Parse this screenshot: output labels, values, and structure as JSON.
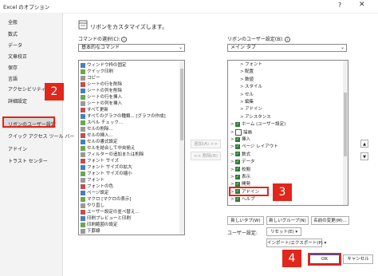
{
  "window": {
    "title": "Excel のオプション",
    "help": "?",
    "close": "✕"
  },
  "sidebar": {
    "items": [
      {
        "label": "全般"
      },
      {
        "label": "数式"
      },
      {
        "label": "データ"
      },
      {
        "label": "文章校正"
      },
      {
        "label": "保存"
      },
      {
        "label": "言語"
      },
      {
        "label": "アクセシビリティ"
      },
      {
        "label": "詳細設定"
      },
      {
        "label": "リボンのユーザー設定"
      },
      {
        "label": "クイック アクセス ツール バー"
      },
      {
        "label": "アドイン"
      },
      {
        "label": "トラスト センター"
      }
    ],
    "active_index": 8
  },
  "annotations": {
    "step2": "2",
    "step3": "3",
    "step4": "4"
  },
  "main": {
    "title": "リボンをカスタマイズします。",
    "commands_label": "コマンドの選択(C):",
    "commands_select": "基本的なコマンド",
    "ribbon_label": "リボンのユーザー設定(B):",
    "ribbon_select": "メイン タブ",
    "command_list": [
      "ウィンドウ枠の固定",
      "クイック印刷",
      "コピー",
      "シートの行を削除",
      "シートの列を削除",
      "シートの行を挿入",
      "シートの列を挿入",
      "すべて更新",
      "すべてのグラフの種類... [グラフの作成]",
      "スペル チェック...",
      "セルの削除...",
      "セルの挿入...",
      "セルの書式設定",
      "セルを結合して中央揃え",
      "フィルターの追加または削除",
      "フォント サイズ",
      "フォント サイズの拡大",
      "フォント サイズの縮小",
      "フォント",
      "フォントの色",
      "ページ設定",
      "マクロ [マクロの表示]",
      "やり直し",
      "ユーザー設定の並べ替え...",
      "印刷プレビューと印刷",
      "印刷範囲の設定",
      "下罫線"
    ],
    "add_button": "追加(A) >>",
    "remove_button": "<< 削除(R)",
    "tree": [
      {
        "label": "フォント",
        "indent": 2,
        "chev": ">",
        "checked": false
      },
      {
        "label": "配置",
        "indent": 2,
        "chev": ">",
        "checked": false
      },
      {
        "label": "数値",
        "indent": 2,
        "chev": ">",
        "checked": false
      },
      {
        "label": "スタイル",
        "indent": 2,
        "chev": ">",
        "checked": false
      },
      {
        "label": "セル",
        "indent": 2,
        "chev": ">",
        "checked": false
      },
      {
        "label": "編集",
        "indent": 2,
        "chev": ">",
        "checked": false
      },
      {
        "label": "アドイン",
        "indent": 2,
        "chev": ">",
        "checked": false
      },
      {
        "label": "アシスタンス",
        "indent": 2,
        "chev": ">",
        "checked": false
      },
      {
        "label": "ホーム (ユーザー設定)",
        "indent": 0,
        "chev": ">",
        "checked": true
      },
      {
        "label": "描画",
        "indent": 0,
        "chev": ">",
        "checked": false
      },
      {
        "label": "挿入",
        "indent": 0,
        "chev": ">",
        "checked": true
      },
      {
        "label": "ページ レイアウト",
        "indent": 0,
        "chev": ">",
        "checked": true
      },
      {
        "label": "数式",
        "indent": 0,
        "chev": ">",
        "checked": true
      },
      {
        "label": "データ",
        "indent": 0,
        "chev": ">",
        "checked": true
      },
      {
        "label": "校閲",
        "indent": 0,
        "chev": ">",
        "checked": true
      },
      {
        "label": "表示",
        "indent": 0,
        "chev": ">",
        "checked": true
      },
      {
        "label": "開発",
        "indent": 0,
        "chev": ">",
        "checked": true
      },
      {
        "label": "アドイン",
        "indent": 0,
        "chev": ">",
        "checked": true
      },
      {
        "label": "ヘルプ",
        "indent": 0,
        "chev": ">",
        "checked": true
      }
    ],
    "new_tab": "新しいタブ(W)",
    "new_group": "新しいグループ(N)",
    "rename": "名前の変更(M)...",
    "user_settings_label": "ユーザー設定:",
    "reset": "リセット(E) ▾",
    "import_export": "インポート/エクスポート(P) ▾",
    "ok": "OK",
    "cancel": "キャンセル",
    "up_arrow": "▲",
    "down_arrow": "▼"
  }
}
